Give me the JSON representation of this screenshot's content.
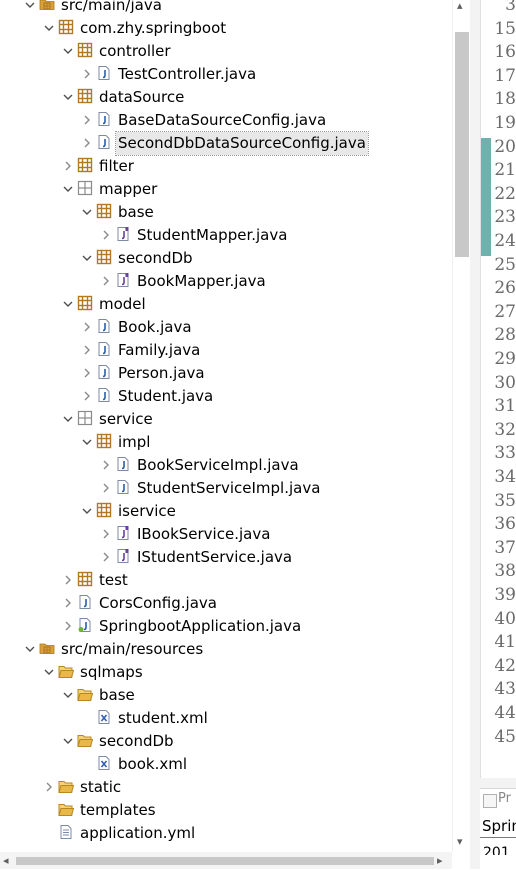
{
  "tree": [
    {
      "label": "src/main/java",
      "level": 1,
      "tw": "down",
      "icon": "source-folder-icon"
    },
    {
      "label": "com.zhy.springboot",
      "level": 2,
      "tw": "down",
      "icon": "package-icon"
    },
    {
      "label": "controller",
      "level": 3,
      "tw": "down",
      "icon": "package-icon"
    },
    {
      "label": "TestController.java",
      "level": 4,
      "tw": "right",
      "icon": "java-file-icon"
    },
    {
      "label": "dataSource",
      "level": 3,
      "tw": "down",
      "icon": "package-icon"
    },
    {
      "label": "BaseDataSourceConfig.java",
      "level": 4,
      "tw": "right",
      "icon": "java-file-icon"
    },
    {
      "label": "SecondDbDataSourceConfig.java",
      "level": 4,
      "tw": "right",
      "icon": "java-file-icon",
      "selected": true
    },
    {
      "label": "filter",
      "level": 3,
      "tw": "right",
      "icon": "package-icon"
    },
    {
      "label": "mapper",
      "level": 3,
      "tw": "down",
      "icon": "empty-package-icon"
    },
    {
      "label": "base",
      "level": 4,
      "tw": "down",
      "icon": "package-icon"
    },
    {
      "label": "StudentMapper.java",
      "level": 5,
      "tw": "right",
      "icon": "interface-file-icon"
    },
    {
      "label": "secondDb",
      "level": 4,
      "tw": "down",
      "icon": "package-icon"
    },
    {
      "label": "BookMapper.java",
      "level": 5,
      "tw": "right",
      "icon": "interface-file-icon"
    },
    {
      "label": "model",
      "level": 3,
      "tw": "down",
      "icon": "package-icon"
    },
    {
      "label": "Book.java",
      "level": 4,
      "tw": "right",
      "icon": "java-file-icon"
    },
    {
      "label": "Family.java",
      "level": 4,
      "tw": "right",
      "icon": "java-file-icon"
    },
    {
      "label": "Person.java",
      "level": 4,
      "tw": "right",
      "icon": "java-file-icon"
    },
    {
      "label": "Student.java",
      "level": 4,
      "tw": "right",
      "icon": "java-file-icon"
    },
    {
      "label": "service",
      "level": 3,
      "tw": "down",
      "icon": "empty-package-icon"
    },
    {
      "label": "impl",
      "level": 4,
      "tw": "down",
      "icon": "package-icon"
    },
    {
      "label": "BookServiceImpl.java",
      "level": 5,
      "tw": "right",
      "icon": "java-file-icon"
    },
    {
      "label": "StudentServiceImpl.java",
      "level": 5,
      "tw": "right",
      "icon": "java-file-icon"
    },
    {
      "label": "iservice",
      "level": 4,
      "tw": "down",
      "icon": "package-icon"
    },
    {
      "label": "IBookService.java",
      "level": 5,
      "tw": "right",
      "icon": "interface-file-icon"
    },
    {
      "label": "IStudentService.java",
      "level": 5,
      "tw": "right",
      "icon": "interface-file-icon"
    },
    {
      "label": "test",
      "level": 3,
      "tw": "right",
      "icon": "package-icon"
    },
    {
      "label": "CorsConfig.java",
      "level": 3,
      "tw": "right",
      "icon": "java-file-icon"
    },
    {
      "label": "SpringbootApplication.java",
      "level": 3,
      "tw": "right",
      "icon": "spring-file-icon"
    },
    {
      "label": "src/main/resources",
      "level": 1,
      "tw": "down",
      "icon": "source-folder-icon"
    },
    {
      "label": "sqlmaps",
      "level": 2,
      "tw": "down",
      "icon": "folder-icon"
    },
    {
      "label": "base",
      "level": 3,
      "tw": "down",
      "icon": "folder-icon"
    },
    {
      "label": "student.xml",
      "level": 4,
      "tw": "none",
      "icon": "xml-file-icon"
    },
    {
      "label": "secondDb",
      "level": 3,
      "tw": "down",
      "icon": "folder-icon"
    },
    {
      "label": "book.xml",
      "level": 4,
      "tw": "none",
      "icon": "xml-file-icon"
    },
    {
      "label": "static",
      "level": 2,
      "tw": "right",
      "icon": "folder-icon"
    },
    {
      "label": "templates",
      "level": 2,
      "tw": "none",
      "icon": "folder-icon"
    },
    {
      "label": "application.yml",
      "level": 2,
      "tw": "none",
      "icon": "text-file-icon"
    }
  ],
  "editor": {
    "line_numbers": [
      "3",
      "15",
      "16",
      "17",
      "18",
      "19",
      "20",
      "21",
      "22",
      "23",
      "24",
      "25",
      "26",
      "27",
      "28",
      "29",
      "30",
      "31",
      "32",
      "33",
      "34",
      "35",
      "36",
      "37",
      "38",
      "39",
      "40",
      "41",
      "42",
      "43",
      "44",
      "45"
    ],
    "change_marker_lines": [
      "20",
      "21",
      "22",
      "23",
      "24"
    ],
    "marker_color": "#6fb1ad",
    "bottom_tab_text": "Pr",
    "bottom_label": "Sprin",
    "bottom_partial": "201"
  },
  "colors": {
    "package": "#b07a24",
    "java_file": "#2c5fa8",
    "folder": "#d9a13a",
    "selection": "#e8e8e8"
  }
}
